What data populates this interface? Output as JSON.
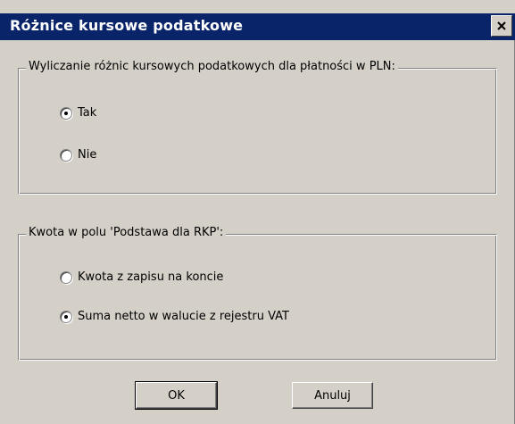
{
  "window": {
    "title": "Różnice kursowe podatkowe",
    "close_icon": "close-icon"
  },
  "group1": {
    "legend": "Wyliczanie różnic kursowych podatkowych dla płatności w PLN:",
    "options": [
      {
        "label": "Tak",
        "selected": true
      },
      {
        "label": "Nie",
        "selected": false
      }
    ]
  },
  "group2": {
    "legend": "Kwota w polu 'Podstawa dla RKP':",
    "options": [
      {
        "label": "Kwota z zapisu na koncie",
        "selected": false
      },
      {
        "label": "Suma netto w walucie z rejestru VAT",
        "selected": true
      }
    ]
  },
  "buttons": {
    "ok": "OK",
    "cancel": "Anuluj"
  }
}
